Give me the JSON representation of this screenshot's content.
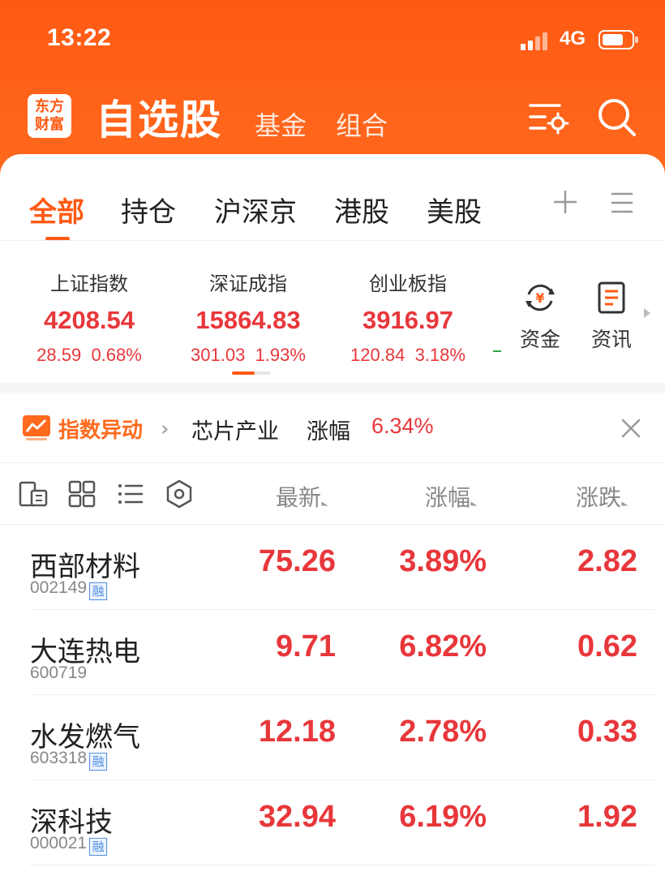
{
  "status": {
    "time": "13:22",
    "network": "4G"
  },
  "header": {
    "logo_line1": "东方",
    "logo_line2": "财富",
    "title": "自选股",
    "nav": [
      "基金",
      "组合"
    ]
  },
  "tabs": [
    "全部",
    "持仓",
    "沪深京",
    "港股",
    "美股"
  ],
  "indices": [
    {
      "name": "上证指数",
      "value": "4208.54",
      "change": "28.59",
      "pct": "0.68%"
    },
    {
      "name": "深证成指",
      "value": "15864.83",
      "change": "301.03",
      "pct": "1.93%"
    },
    {
      "name": "创业板指",
      "value": "3916.97",
      "change": "120.84",
      "pct": "3.18%"
    }
  ],
  "quick_links": [
    {
      "label": "资金",
      "icon": "yuan-cycle-icon"
    },
    {
      "label": "资讯",
      "icon": "news-doc-icon"
    }
  ],
  "alert": {
    "title": "指数异动",
    "sector": "芯片产业",
    "metric": "涨幅",
    "value": "6.34%"
  },
  "columns": [
    "最新",
    "涨幅",
    "涨跌"
  ],
  "stocks": [
    {
      "name": "西部材料",
      "code": "002149",
      "margin": "融",
      "price": "75.26",
      "pct": "3.89%",
      "change": "2.82"
    },
    {
      "name": "大连热电",
      "code": "600719",
      "margin": "",
      "price": "9.71",
      "pct": "6.82%",
      "change": "0.62"
    },
    {
      "name": "水发燃气",
      "code": "603318",
      "margin": "融",
      "price": "12.18",
      "pct": "2.78%",
      "change": "0.33"
    },
    {
      "name": "深科技",
      "code": "000021",
      "margin": "融",
      "price": "32.94",
      "pct": "6.19%",
      "change": "1.92"
    }
  ],
  "colors": {
    "brand": "#ff5a14",
    "up": "#e8373b",
    "down": "#2aa84a"
  }
}
